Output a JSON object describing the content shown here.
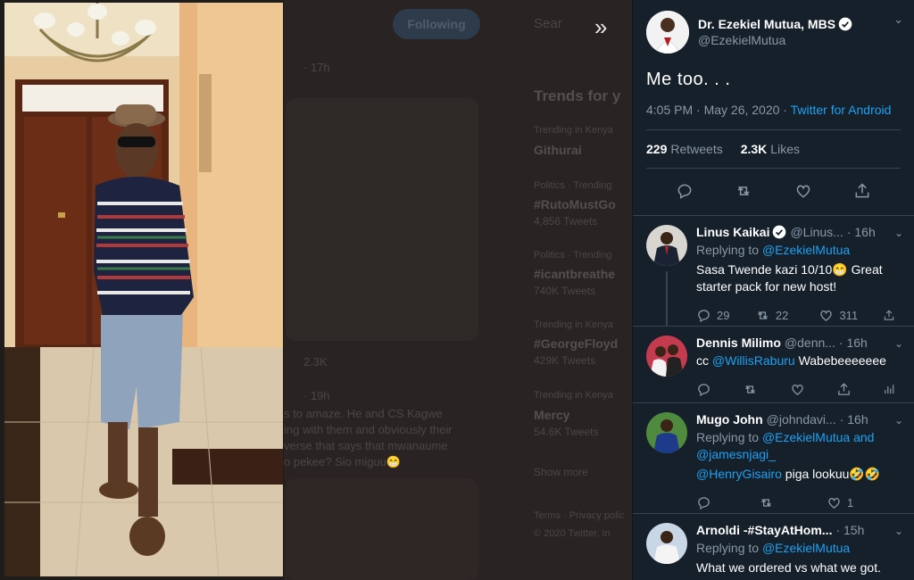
{
  "main_tweet": {
    "author_name": "Dr. Ezekiel Mutua, MBS",
    "author_handle": "@EzekielMutua",
    "text": "Me too. . .",
    "time": "4:05 PM · May 26, 2020 ·",
    "source": "Twitter for Android",
    "retweets_count": "229",
    "retweets_label": "Retweets",
    "likes_count": "2.3K",
    "likes_label": "Likes"
  },
  "replies": [
    {
      "name": "Linus Kaikai",
      "handle": "@Linus...",
      "time": "· 16h",
      "replying_prefix": "Replying to",
      "replying_to": "@EzekielMutua",
      "text": "Sasa Twende kazi 10/10😁 Great starter pack for new host!",
      "replies_count": "29",
      "retweets_count": "22",
      "likes_count": "311"
    },
    {
      "name": "Dennis Milimo",
      "handle": "@denn...",
      "time": "· 16h",
      "text_prefix": "cc",
      "mention": "@WillisRaburu",
      "text_suffix": "Wabebeeeeeee"
    },
    {
      "name": "Mugo John",
      "handle": "@johndavi...",
      "time": "· 16h",
      "replying_prefix": "Replying to",
      "replying_to_1": "@EzekielMutua",
      "and_word": "and",
      "replying_to_2": "@jamesnjagi_",
      "mention": "@HenryGisairo",
      "text_suffix": "piga lookuu🤣🤣",
      "likes_count": "1"
    },
    {
      "name": "Arnoldi -#StayAtHom...",
      "time": "· 15h",
      "replying_prefix": "Replying to",
      "replying_to": "@EzekielMutua",
      "text": "What we ordered vs what we got."
    }
  ],
  "background": {
    "follow_label": "Following",
    "search_placeholder": "Sear",
    "trends_title": "Trends for y",
    "trends": [
      {
        "context": "Trending in Kenya",
        "name": "Githurai",
        "count": ""
      },
      {
        "context": "Politics · Trending",
        "name": "#RutoMustGo",
        "count": "4,856 Tweets"
      },
      {
        "context": "Politics · Trending",
        "name": "#icantbreathe",
        "count": "740K Tweets"
      },
      {
        "context": "Trending in Kenya",
        "name": "#GeorgeFloyd",
        "count": "429K Tweets"
      },
      {
        "context": "Trending in Kenya",
        "name": "Mercy",
        "count": "54.6K Tweets"
      }
    ],
    "show_more": "Show more",
    "tweet_fragments": [
      "s to amaze. He and CS Kagwe",
      "ing with them and obviously their",
      "verse that says that mwanaume",
      "o pekee? Sio miguu😁"
    ],
    "time_frag_1": "· 17h",
    "time_frag_2": "· 19h",
    "stat_frag": "2.3K",
    "footer_frag_1": "Terms · Privacy polic",
    "footer_frag_2": "© 2020 Twitter, In"
  },
  "colors": {
    "panel_bg": "#15202b",
    "link": "#1da1f2",
    "muted": "#8899a6",
    "divider": "#38444d"
  }
}
